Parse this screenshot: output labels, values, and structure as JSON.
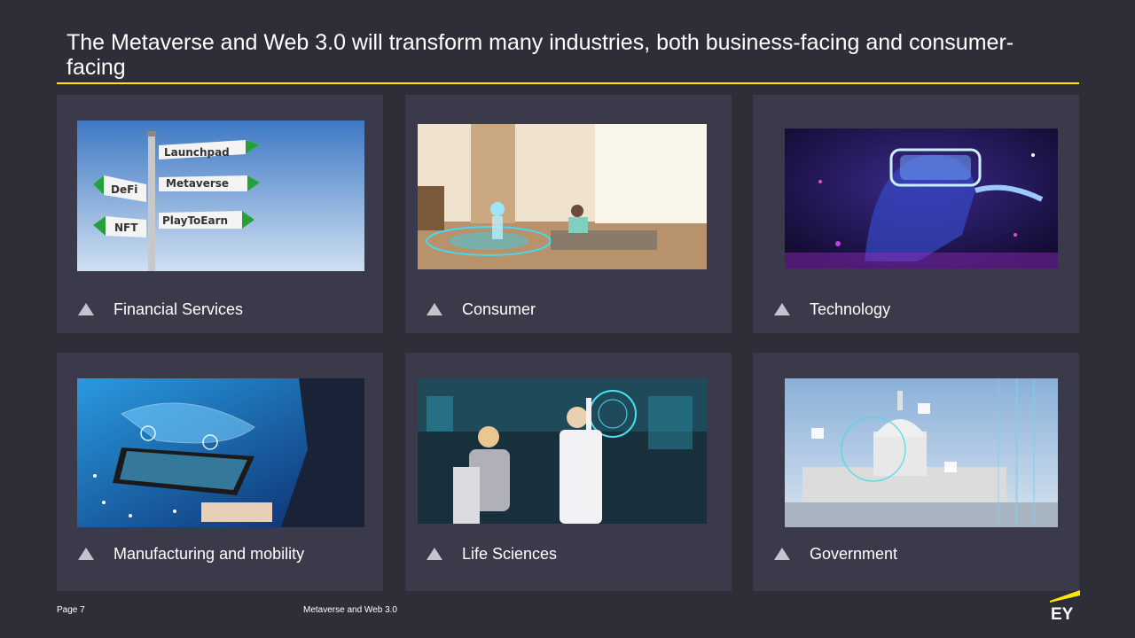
{
  "slide": {
    "title": "The Metaverse and Web 3.0 will transform many industries, both business-facing and consumer-facing"
  },
  "cards": [
    {
      "label": "Financial Services",
      "signs": [
        "Launchpad",
        "Metaverse",
        "PlayToEarn",
        "DeFi",
        "NFT"
      ]
    },
    {
      "label": "Consumer"
    },
    {
      "label": "Technology"
    },
    {
      "label": "Manufacturing and mobility"
    },
    {
      "label": "Life Sciences"
    },
    {
      "label": "Government"
    }
  ],
  "footer": {
    "page": "Page 7",
    "doc_title": "Metaverse and Web 3.0",
    "logo_text": "EY"
  },
  "colors": {
    "background": "#2e2e38",
    "card": "#3a3a4a",
    "accent": "#ffe600"
  }
}
